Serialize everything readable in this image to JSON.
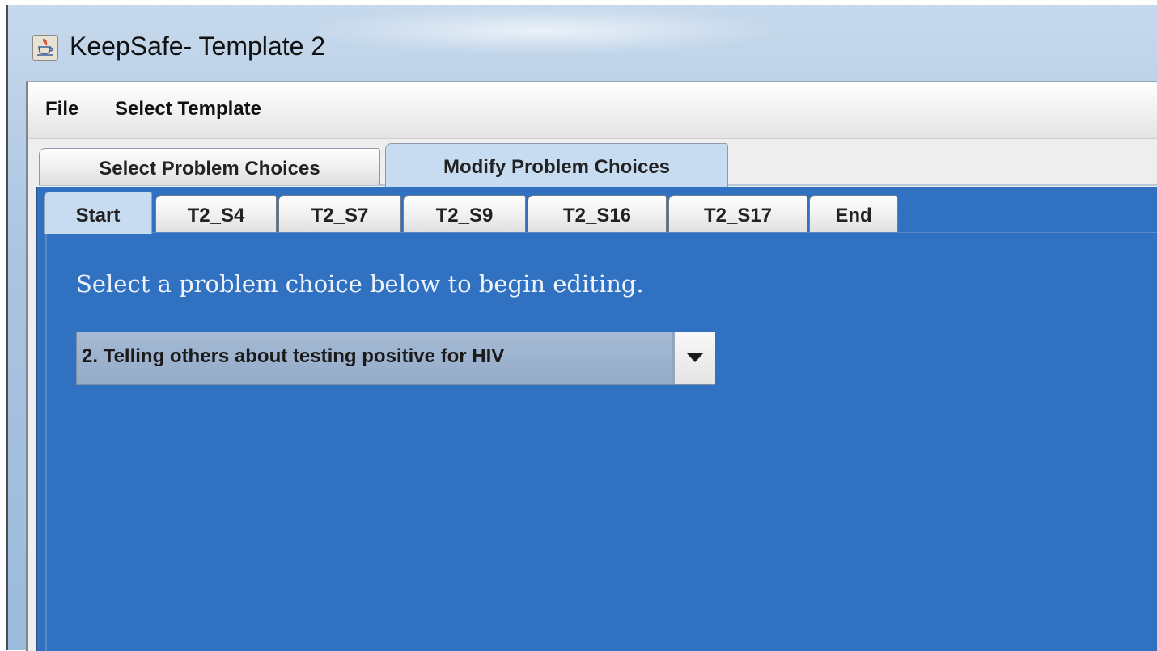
{
  "window": {
    "title": "KeepSafe- Template 2",
    "icon": "java-cup-icon"
  },
  "menubar": {
    "items": [
      {
        "label": "File"
      },
      {
        "label": "Select Template"
      }
    ]
  },
  "outer_tabs": [
    {
      "label": "Select Problem Choices",
      "active": false
    },
    {
      "label": "Modify Problem Choices",
      "active": true
    }
  ],
  "inner_tabs": [
    {
      "label": "Start",
      "active": true
    },
    {
      "label": "T2_S4",
      "active": false
    },
    {
      "label": "T2_S7",
      "active": false
    },
    {
      "label": "T2_S9",
      "active": false
    },
    {
      "label": "T2_S16",
      "active": false
    },
    {
      "label": "T2_S17",
      "active": false
    },
    {
      "label": "End",
      "active": false
    }
  ],
  "panel": {
    "instruction": "Select a problem choice below to begin editing.",
    "combo": {
      "selected": "2. Telling others about testing positive for HIV",
      "arrow_icon": "chevron-down-icon"
    }
  },
  "colors": {
    "panel_background": "#3072c1",
    "active_tab": "#c7dcf0",
    "combo_background": "#94acc9"
  }
}
